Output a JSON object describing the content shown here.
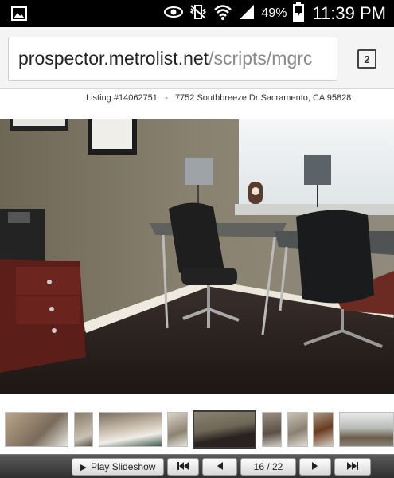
{
  "status_bar": {
    "battery_percent": "49%",
    "time": "11:39 PM",
    "icons": [
      "image-notification-icon",
      "eye-icon",
      "vibrate-icon",
      "wifi-icon",
      "signal-icon",
      "battery-charging-icon"
    ]
  },
  "browser": {
    "url_host": "prospector.metrolist.net",
    "url_path": "/scripts/mgrc",
    "tab_count": "2"
  },
  "listing": {
    "number": "Listing #14062751",
    "separator": "-",
    "address": "7752 Southbreeze Dr Sacramento, CA 95828"
  },
  "thumbnails": [
    {
      "label": "bathroom-sink-thumbnail"
    },
    {
      "label": "bathroom-thumbnail"
    },
    {
      "label": "bedroom-thumbnail"
    },
    {
      "label": "room-thumbnail"
    },
    {
      "label": "office-thumbnail",
      "active": true
    },
    {
      "label": "hallway-thumbnail"
    },
    {
      "label": "shower-thumbnail"
    },
    {
      "label": "doorway-thumbnail"
    },
    {
      "label": "backyard-thumbnail"
    }
  ],
  "controls": {
    "play_label": "Play Slideshow",
    "counter": "16 / 22",
    "first_icon": "skip-to-first-icon",
    "prev_icon": "previous-icon",
    "next_icon": "next-icon",
    "last_icon": "skip-to-last-icon"
  },
  "colors": {
    "status_bar": "#000000",
    "control_bar": "#3c3c3c"
  }
}
